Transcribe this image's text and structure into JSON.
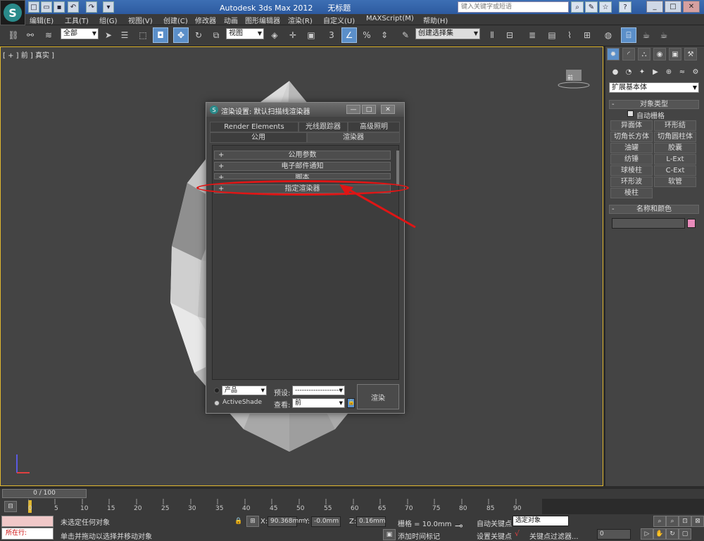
{
  "app": {
    "title": "Autodesk 3ds Max  2012",
    "title_suffix": "无标题",
    "search_placeholder": "键入关键字或短语"
  },
  "menu": [
    "编辑(E)",
    "工具(T)",
    "组(G)",
    "视图(V)",
    "创建(C)",
    "修改器",
    "动画",
    "图形编辑器",
    "渲染(R)",
    "自定义(U)",
    "MAXScript(M)",
    "帮助(H)"
  ],
  "toolbar": {
    "selection_filter": "全部",
    "ref_coord": "视图",
    "named_selection": "创建选择集"
  },
  "viewport": {
    "label": "[ + ] 前 ] 真实 ]",
    "viewcube_label": "前"
  },
  "command_panel": {
    "category": "扩展基本体",
    "object_type_title": "对象类型",
    "autogrid_label": "自动栅格",
    "buttons": [
      "异面体",
      "环形结",
      "切角长方体",
      "切角圆柱体",
      "油罐",
      "胶囊",
      "纺锤",
      "L-Ext",
      "球棱柱",
      "C-Ext",
      "环形波",
      "软管",
      "棱柱"
    ],
    "name_color_title": "名称和颜色",
    "color_swatch": "#e88bbb"
  },
  "render_dialog": {
    "title": "渲染设置: 默认扫描线渲染器",
    "tabs_row1": [
      "Render Elements",
      "光线跟踪器",
      "高级照明"
    ],
    "tabs_row2": [
      "公用",
      "渲染器"
    ],
    "rollouts": [
      "公用参数",
      "电子邮件通知",
      "脚本",
      "指定渲染器"
    ],
    "mode_production": "产品",
    "mode_activeshade": "ActiveShade",
    "preset_label": "预设:",
    "preset_value": "--------------------",
    "view_label": "查看:",
    "view_value": "前",
    "render_button": "渲染"
  },
  "timeline": {
    "frame_display": "0 / 100",
    "ticks": [
      "0",
      "5",
      "10",
      "15",
      "20",
      "25",
      "30",
      "35",
      "40",
      "45",
      "50",
      "55",
      "60",
      "65",
      "70",
      "75",
      "80",
      "85",
      "90"
    ]
  },
  "status": {
    "running_label": "所在行:",
    "selection_status": "未选定任何对象",
    "prompt": "单击并拖动以选择并移动对象",
    "x_label": "X:",
    "x_value": "90.368mm",
    "y_label": "Y:",
    "y_value": "-0.0mm",
    "z_label": "Z:",
    "z_value": "0.16mm",
    "grid": "栅格 = 10.0mm",
    "add_time_tag": "添加时间标记",
    "auto_key": "自动关键点",
    "selected_object": "选定对象",
    "set_key": "设置关键点",
    "key_filters": "关键点过滤器...",
    "frame_field": "0"
  },
  "colors": {
    "viewport_border": "#e1b82f",
    "highlight": "#e01515",
    "active_tool": "#5b8fc9"
  }
}
